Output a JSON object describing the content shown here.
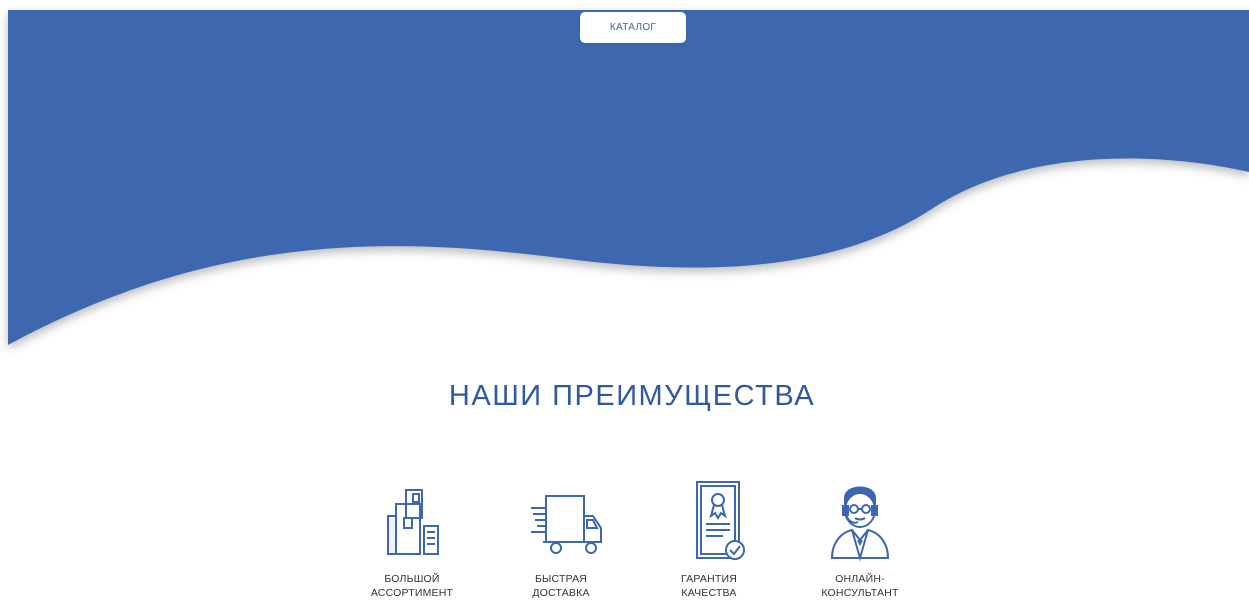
{
  "colors": {
    "accent": "#3d67b0",
    "title": "#2f58a8",
    "background": "#ffffff"
  },
  "hero": {
    "catalog_button": "КАТАЛОГ"
  },
  "advantages": {
    "title": "НАШИ ПРЕИМУЩЕСТВА",
    "items": [
      {
        "icon": "assortment-icon",
        "line1": "БОЛЬШОЙ",
        "line2": "АССОРТИМЕНТ"
      },
      {
        "icon": "delivery-truck-icon",
        "line1": "БЫСТРАЯ",
        "line2": "ДОСТАВКА"
      },
      {
        "icon": "quality-certificate-icon",
        "line1": "ГАРАНТИЯ",
        "line2": "КАЧЕСТВА"
      },
      {
        "icon": "online-consultant-icon",
        "line1": "ОНЛАЙН-",
        "line2": "КОНСУЛЬТАНТ"
      }
    ]
  }
}
